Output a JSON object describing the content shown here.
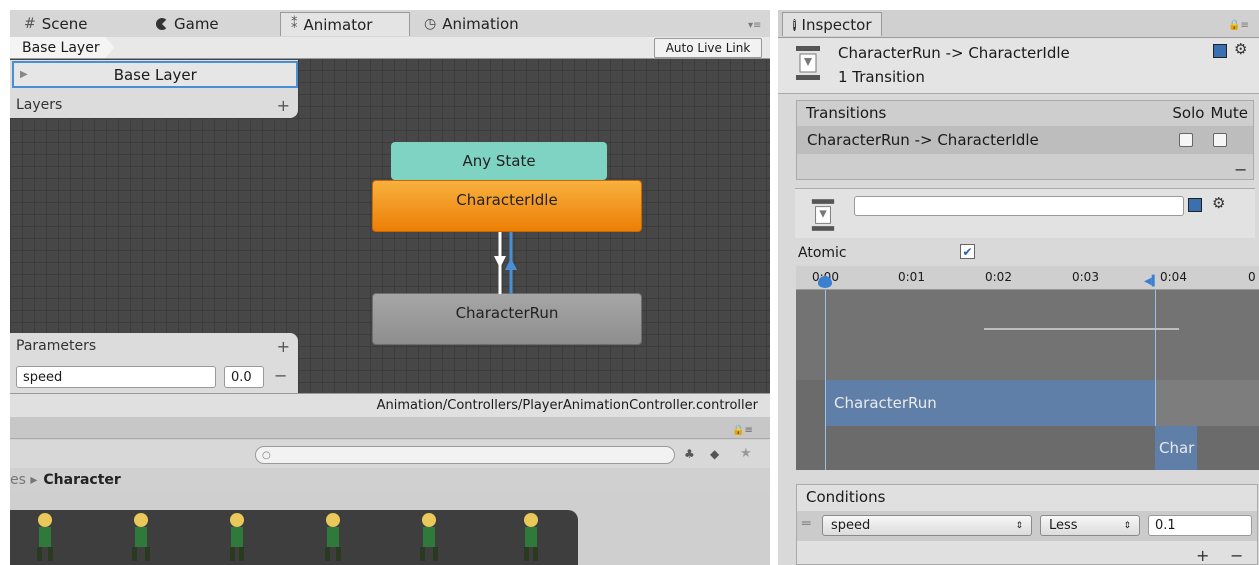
{
  "tabs": [
    {
      "label": "Scene",
      "icon": "grid-icon"
    },
    {
      "label": "Game",
      "icon": "pacman-icon"
    },
    {
      "label": "Animator",
      "icon": "animator-icon"
    },
    {
      "label": "Animation",
      "icon": "clock-icon"
    }
  ],
  "animator": {
    "breadcrumb": "Base Layer",
    "auto_live_link": "Auto Live Link",
    "layer_name": "Base Layer",
    "layers_label": "Layers",
    "layers_add": "+",
    "parameters_label": "Parameters",
    "parameters_add": "+",
    "param_name": "speed",
    "param_value": "0.0",
    "param_remove": "−",
    "states": {
      "any": "Any State",
      "idle": "CharacterIdle",
      "run": "CharacterRun"
    },
    "status_path": "Animation/Controllers/PlayerAnimationController.controller"
  },
  "project": {
    "search_placeholder": "",
    "breadcrumb_prefix": "es ▸",
    "breadcrumb_current": "Character"
  },
  "inspector": {
    "tab_label": "Inspector",
    "title": "CharacterRun -> CharacterIdle",
    "subtitle": "1 Transition",
    "transitions_header": "Transitions",
    "solo_label": "Solo",
    "mute_label": "Mute",
    "transition_row": "CharacterRun -> CharacterIdle",
    "remove_label": "−",
    "name_field_value": "",
    "atomic_label": "Atomic",
    "atomic_checked": true,
    "timeline_ticks": [
      "0:00",
      "0:01",
      "0:02",
      "0:03",
      "0:04",
      "0"
    ],
    "timeline_clip_run": "CharacterRun",
    "timeline_clip_idle": "Char",
    "conditions_label": "Conditions",
    "condition": {
      "param": "speed",
      "op": "Less",
      "value": "0.1"
    },
    "add_label": "+",
    "minus_label": "−"
  },
  "colors": {
    "any_state": "#7fd3c2",
    "idle_state": "#f08a10",
    "run_state": "#9a9a9a",
    "clip_run": "#5f7fa8",
    "selection": "#4a8fd6"
  }
}
